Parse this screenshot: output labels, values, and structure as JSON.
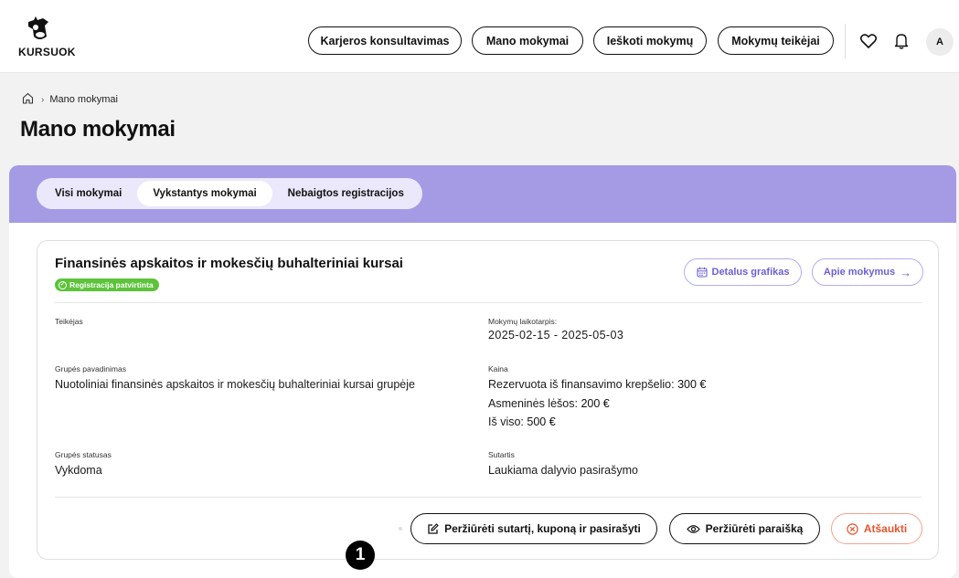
{
  "header": {
    "logo_text": "KURSUOK",
    "nav": [
      {
        "label": "Karjeros konsultavimas"
      },
      {
        "label": "Mano mokymai"
      },
      {
        "label": "Ieškoti mokymų"
      },
      {
        "label": "Mokymų teikėjai"
      }
    ],
    "avatar_initial": "A",
    "icons": [
      "heart-icon",
      "bell-icon"
    ]
  },
  "breadcrumb": {
    "home_icon": "home-icon",
    "current": "Mano mokymai"
  },
  "page_title": "Mano mokymai",
  "tabs": [
    {
      "label": "Visi mokymai",
      "active": false
    },
    {
      "label": "Vykstantys mokymai",
      "active": true
    },
    {
      "label": "Nebaigtos registracijos",
      "active": false
    }
  ],
  "course": {
    "title": "Finansinės apskaitos ir mokesčių buhalteriniai kursai",
    "badge": "Registracija patvirtinta",
    "schedule_button": "Detalus grafikas",
    "about_button": "Apie mokymus",
    "provider_label": "Teikėjas",
    "period_label": "Mokymų laikotarpis:",
    "period_value": "2025-02-15 - 2025-05-03",
    "group_name_label": "Grupės pavadinimas",
    "group_name_value": "Nuotoliniai finansinės apskaitos ir mokesčių buhalteriniai kursai grupėje",
    "price_label": "Kaina",
    "price_reserved_label": "Rezervuota iš finansavimo krepšelio:",
    "price_reserved_value": "300 €",
    "price_own_label": "Asmeninės lėšos:",
    "price_own_value": "200 €",
    "price_total_label": "Iš viso:",
    "price_total_value": "500 €",
    "group_status_label": "Grupės statusas",
    "group_status_value": "Vykdoma",
    "contract_label": "Sutartis",
    "contract_value": "Laukiama dalyvio pasirašymo",
    "actions": {
      "review_sign": "Peržiūrėti sutartį, kuponą ir pasirašyti",
      "view_application": "Peržiūrėti paraišką",
      "cancel": "Atšaukti"
    }
  },
  "marker_label": "1",
  "colors": {
    "accent_purple": "#a59be4",
    "badge_green": "#5cc33a",
    "cancel_red": "#e5552f"
  }
}
